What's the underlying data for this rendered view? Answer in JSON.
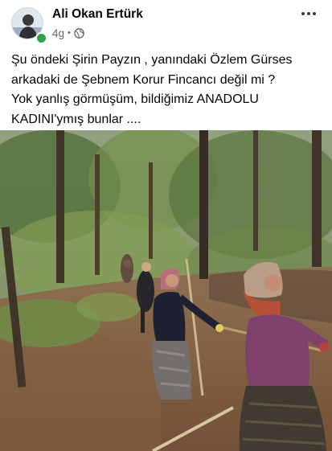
{
  "post": {
    "author": "Ali Okan Ertürk",
    "time": "4g",
    "separator": "•",
    "audience_icon": "globe-icon",
    "menu_icon": "more-horizontal-icon",
    "caption": "Şu öndeki Şirin Payzın , yanındaki Özlem Gürses\narkadaki de Şebnem Korur Fincancı değil mi ?\nYok yanlış görmüşüm, bildiğimiz ANADOLU\nKADINI'ymış bunlar ....",
    "photo": {
      "subject": "women-working-in-burned-forest"
    }
  },
  "colors": {
    "online": "#31a24c",
    "meta_text": "#65676b",
    "text": "#050505"
  }
}
